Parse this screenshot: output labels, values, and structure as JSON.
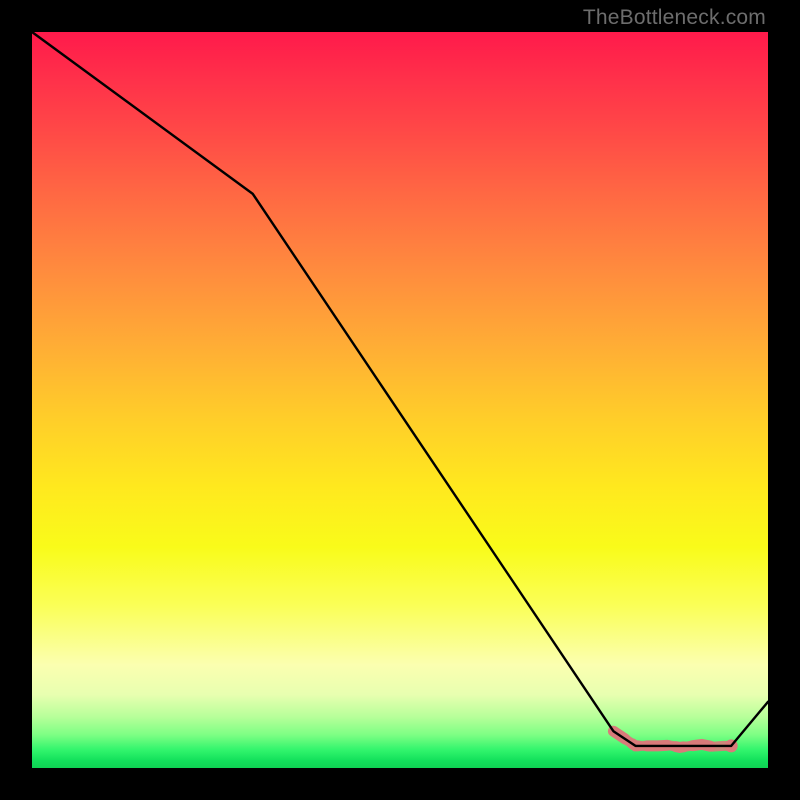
{
  "watermark": "TheBottleneck.com",
  "chart_data": {
    "type": "line",
    "title": "",
    "xlabel": "",
    "ylabel": "",
    "xlim": [
      0,
      100
    ],
    "ylim": [
      0,
      100
    ],
    "grid": false,
    "series": [
      {
        "name": "bottleneck-curve",
        "color": "#000000",
        "x": [
          0,
          30,
          79,
          82,
          85.5,
          89.5,
          91,
          95,
          100
        ],
        "values": [
          100,
          78,
          5,
          3,
          3,
          3,
          3,
          3,
          9
        ]
      }
    ],
    "markers": {
      "name": "highlight-band",
      "color": "#d97a7a",
      "x": [
        79,
        82,
        83.5,
        85,
        86.5,
        88,
        89.5,
        91,
        92.5,
        94,
        95
      ],
      "values": [
        5,
        3,
        3,
        3,
        3.1,
        2.8,
        3.0,
        3.2,
        2.9,
        3.0,
        3
      ]
    }
  }
}
